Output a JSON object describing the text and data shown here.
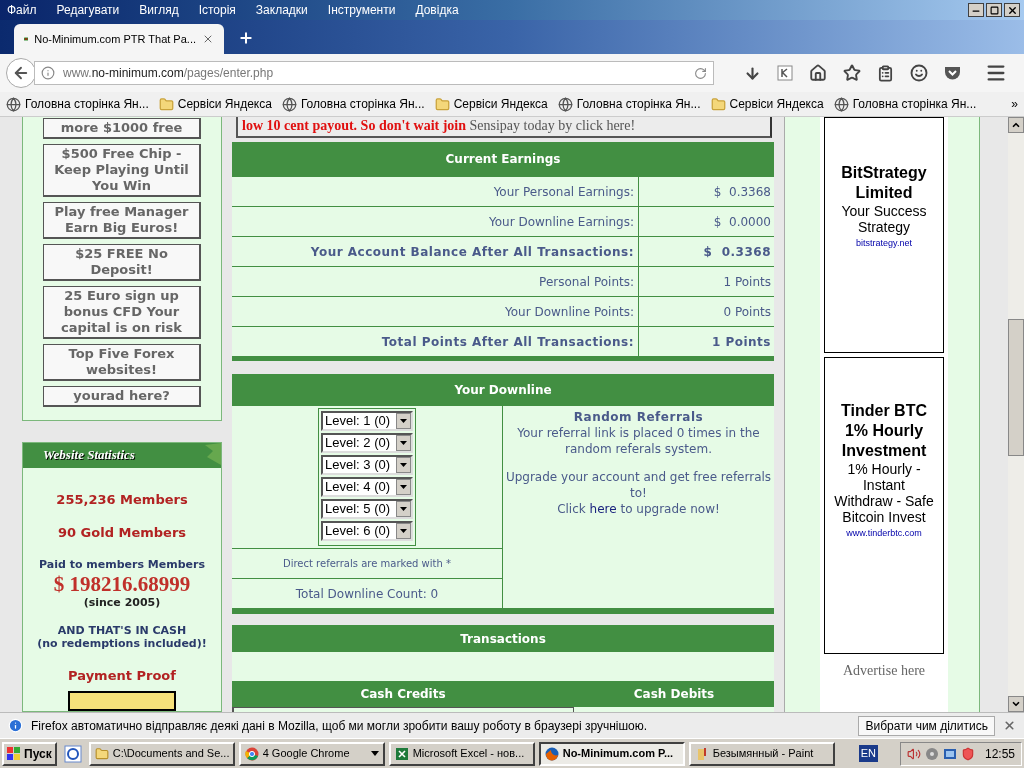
{
  "menu": [
    "Файл",
    "Редагувати",
    "Вигляд",
    "Історія",
    "Закладки",
    "Інструменти",
    "Довідка"
  ],
  "tab": {
    "title": "No-Minimum.com PTR That Pa..."
  },
  "url": {
    "prefix": "www.",
    "domain": "no-minimum.com",
    "path": "/pages/enter.php"
  },
  "bookmarks": [
    {
      "label": "Головна сторінка Ян...",
      "kind": "globe"
    },
    {
      "label": "Сервіси Яндекса",
      "kind": "folder"
    },
    {
      "label": "Головна сторінка Ян...",
      "kind": "globe"
    },
    {
      "label": "Сервіси Яндекса",
      "kind": "folder"
    },
    {
      "label": "Головна сторінка Ян...",
      "kind": "globe"
    },
    {
      "label": "Сервіси Яндекса",
      "kind": "folder"
    },
    {
      "label": "Головна сторінка Ян...",
      "kind": "globe"
    }
  ],
  "bookmarks_more": "»",
  "sidebar_ads": [
    "more $1000 free",
    "$500 Free Chip - Keep Playing Until You Win",
    "Play free Manager Earn Big Euros!",
    "$25 FREE No Deposit!",
    "25 Euro sign up bonus CFD Your capital is on risk",
    "Top Five Forex websites!",
    "yourad here?"
  ],
  "stats": {
    "title": "Website Statistics",
    "members": "255,236 Members",
    "gold": "90 Gold Members",
    "paid_label": "Paid to members Members",
    "paid_amount": "$ 198216.68999",
    "since": "(since 2005)",
    "cash_line1": "AND THAT'S IN CASH",
    "cash_line2": "(no redemptions included)!",
    "payment_proof": "Payment Proof"
  },
  "banner": {
    "red_text": "low 10 cent payout. So don't wait join",
    "link_text": "Sensipay today by click here!"
  },
  "earnings": {
    "title": "Current Earnings",
    "rows": [
      {
        "label": "Your Personal Earnings:",
        "value": "$  0.3368",
        "bold": false
      },
      {
        "label": "Your Downline Earnings:",
        "value": "$  0.0000",
        "bold": false
      },
      {
        "label": "Your Account Balance After All Transactions:",
        "value": "$  0.3368",
        "bold": true
      },
      {
        "label": "Personal Points:",
        "value": "1 Points",
        "bold": false
      },
      {
        "label": "Your Downline Points:",
        "value": "0 Points",
        "bold": false
      },
      {
        "label": "Total Points After All Transactions:",
        "value": "1 Points",
        "bold": true
      }
    ]
  },
  "downline": {
    "title": "Your Downline",
    "levels": [
      "Level: 1 (0)",
      "Level: 2 (0)",
      "Level: 3 (0)",
      "Level: 4 (0)",
      "Level: 5 (0)",
      "Level: 6 (0)"
    ],
    "note": "Direct referrals are marked with *",
    "total": "Total Downline Count: 0",
    "random": {
      "title": "Random Referrals",
      "text": "Your referral link is placed 0 times in the random referals system.",
      "upgrade": "Upgrade your account and get free referrals to!",
      "click_pre": "Click",
      "link": "here",
      "click_post": "to upgrade now!"
    }
  },
  "transactions": {
    "title": "Transactions",
    "columns": [
      "Cash Credits",
      "Cash Debits"
    ]
  },
  "right_ads": [
    {
      "title": "BitStrategy Limited",
      "text": "Your Success Strategy",
      "url": "bitstrategy.net"
    },
    {
      "title": "Tinder BTC 1% Hourly Investment",
      "text": "1% Hourly - Instant Withdraw - Safe Bitcoin Invest",
      "url": "www.tinderbtc.com"
    }
  ],
  "advertise": "Advertise here",
  "notification": {
    "text": "Firefox автоматично відправляє деякі дані в Mozilla, щоб ми могли зробити вашу роботу в браузері зручнішою.",
    "button": "Вибрати чим ділитись"
  },
  "taskbar": {
    "start": "Пуск",
    "items": [
      {
        "label": "C:\\Documents and Se...",
        "kind": "folder",
        "selected": false
      },
      {
        "label": "4 Google Chrome",
        "kind": "chrome",
        "selected": false
      },
      {
        "label": "Microsoft Excel - нов...",
        "kind": "excel",
        "selected": false
      },
      {
        "label": "No-Minimum.com P...",
        "kind": "firefox",
        "selected": true
      },
      {
        "label": "Безымянный - Paint",
        "kind": "paint",
        "selected": false
      }
    ],
    "lang": "EN",
    "clock": "12:55"
  }
}
